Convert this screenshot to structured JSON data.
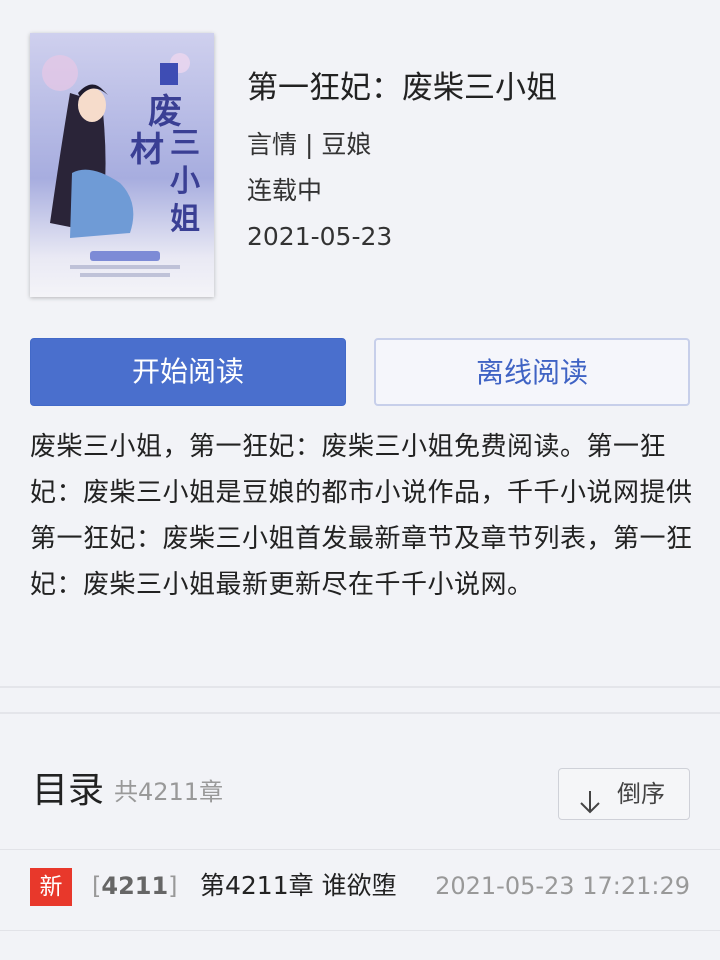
{
  "book": {
    "title": "第一狂妃：废柴三小姐",
    "genre_author": "言情 | 豆娘",
    "status": "连载中",
    "date": "2021-05-23",
    "cover_title": "废材三小姐",
    "cover_series": "第一狂妃",
    "cover_author": "豆娘/著"
  },
  "actions": {
    "read_label": "开始阅读",
    "offline_label": "离线阅读"
  },
  "intro": "废柴三小姐，第一狂妃：废柴三小姐免费阅读。第一狂妃：废柴三小姐是豆娘的都市小说作品，千千小说网提供第一狂妃：废柴三小姐首发最新章节及章节列表，第一狂妃：废柴三小姐最新更新尽在千千小说网。",
  "toc": {
    "title": "目录",
    "count": "共4211章",
    "sort_label": "倒序"
  },
  "chapters": [
    {
      "badge": "新",
      "bracket_open": "[",
      "number": "4211",
      "bracket_close": "]",
      "title": "第4211章 谁欲堕",
      "time": "2021-05-23 17:21:29"
    }
  ],
  "colors": {
    "accent": "#4a6fcd",
    "badge_new": "#e8382b",
    "background": "#f2f3f7"
  }
}
